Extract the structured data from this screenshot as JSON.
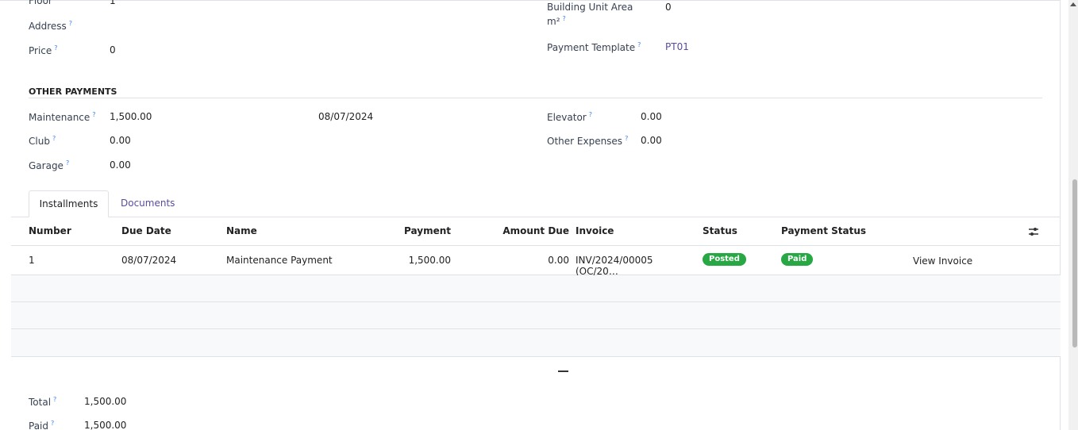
{
  "fields_top": {
    "floor_label": "Floor",
    "floor_value": "1",
    "address_label": "Address",
    "price_label": "Price",
    "price_value": "0",
    "building_area_label_line1": "Building Unit Area",
    "building_area_label_line2": "m²",
    "building_area_value": "0",
    "payment_template_label": "Payment Template",
    "payment_template_value": "PT01"
  },
  "other_payments": {
    "title": "OTHER PAYMENTS",
    "maintenance_label": "Maintenance",
    "maintenance_value": "1,500.00",
    "maintenance_date": "08/07/2024",
    "club_label": "Club",
    "club_value": "0.00",
    "garage_label": "Garage",
    "garage_value": "0.00",
    "elevator_label": "Elevator",
    "elevator_value": "0.00",
    "other_expenses_label": "Other Expenses",
    "other_expenses_value": "0.00"
  },
  "help_mark": "?",
  "tabs": [
    {
      "label": "Installments",
      "active": true
    },
    {
      "label": "Documents",
      "active": false
    }
  ],
  "table": {
    "headers": {
      "number": "Number",
      "due_date": "Due Date",
      "name": "Name",
      "payment": "Payment",
      "amount_due": "Amount Due",
      "invoice": "Invoice",
      "status": "Status",
      "payment_status": "Payment Status"
    },
    "rows": [
      {
        "number": "1",
        "due_date": "08/07/2024",
        "name": "Maintenance Payment",
        "payment": "1,500.00",
        "amount_due": "0.00",
        "invoice": "INV/2024/00005 (OC/20…",
        "status": "Posted",
        "payment_status": "Paid",
        "action": "View Invoice"
      }
    ]
  },
  "totals": {
    "total_label": "Total",
    "total_value": "1,500.00",
    "paid_label": "Paid",
    "paid_value": "1,500.00"
  },
  "colors": {
    "badge_green": "#28a745",
    "link_purple": "#5b4a9e",
    "help_blue": "#3b82f6"
  }
}
